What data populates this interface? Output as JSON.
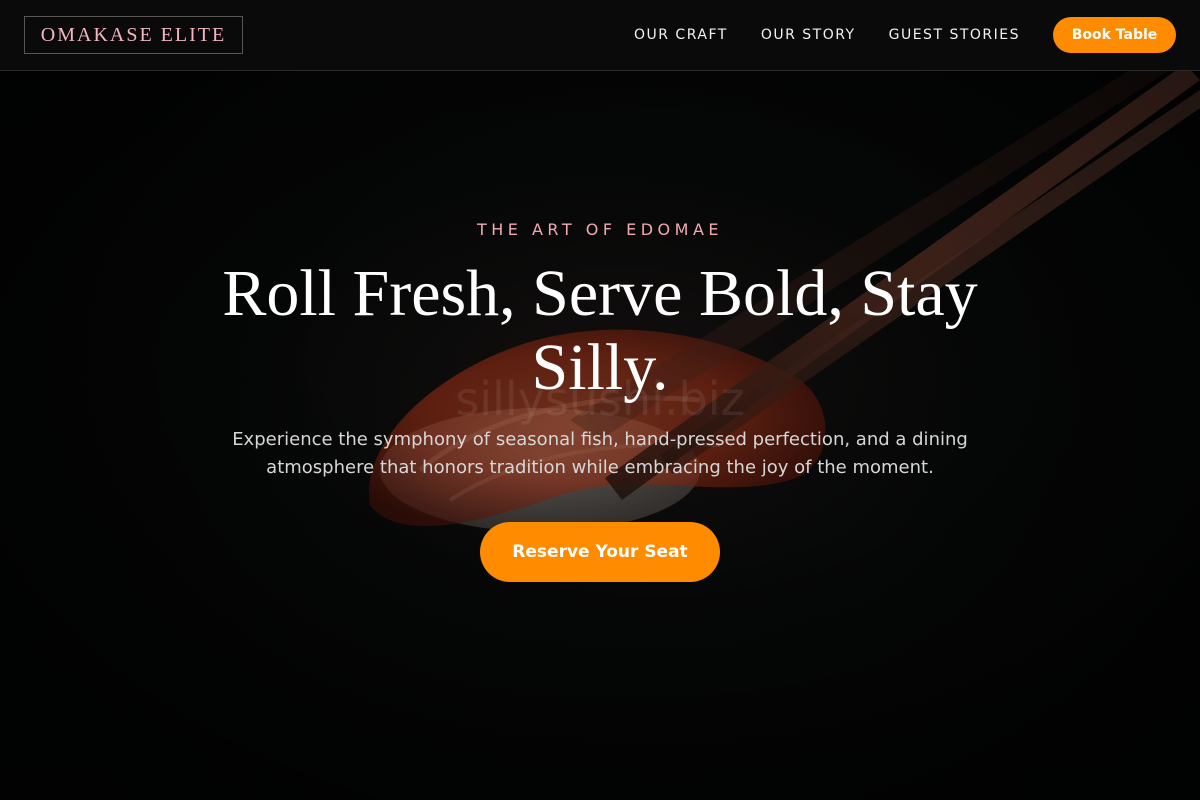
{
  "header": {
    "logo": "OMAKASE ELITE",
    "nav": [
      {
        "label": "OUR CRAFT"
      },
      {
        "label": "OUR STORY"
      },
      {
        "label": "GUEST STORIES"
      }
    ],
    "book_label": "Book Table"
  },
  "hero": {
    "eyebrow": "THE ART OF EDOMAE",
    "headline": "Roll Fresh, Serve Bold, Stay Silly.",
    "subtext": "Experience the symphony of seasonal fish, hand-pressed perfection, and a dining atmosphere that honors tradition while embracing the joy of the moment.",
    "cta_label": "Reserve Your Seat",
    "watermark": "sillysushi.biz"
  },
  "colors": {
    "accent": "#ff8c00",
    "logo_pink": "#f3b6c0",
    "background": "#060707"
  },
  "icons": {
    "background_image": "sushi-with-chopsticks-photo"
  }
}
